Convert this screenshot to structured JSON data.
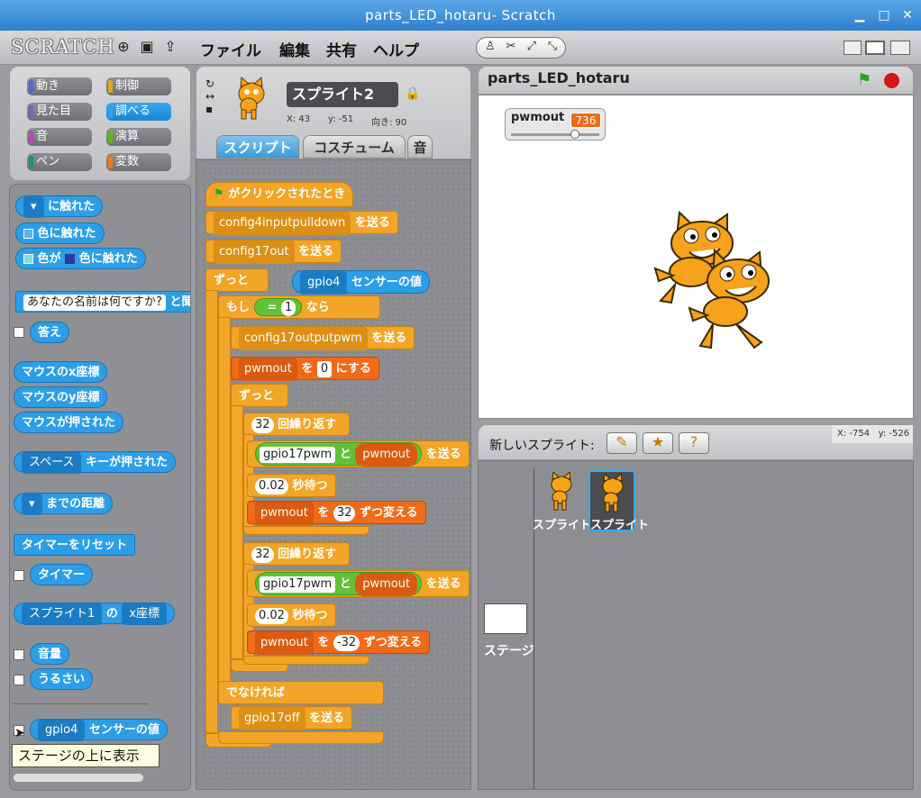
{
  "window": {
    "title": "parts_LED_hotaru- Scratch",
    "minimize_icon": "minimize-icon",
    "maximize_icon": "maximize-icon",
    "close_icon": "close-icon"
  },
  "menubar": {
    "logo": "SCRATCH",
    "menus": [
      "ファイル",
      "編集",
      "共有",
      "ヘルプ"
    ]
  },
  "categories": [
    {
      "label": "動き",
      "color": "#4a6cd4"
    },
    {
      "label": "制御",
      "color": "#e1a91a"
    },
    {
      "label": "見た目",
      "color": "#8a55d7"
    },
    {
      "label": "調べる",
      "color": "#2ca5e2"
    },
    {
      "label": "音",
      "color": "#bb42c3"
    },
    {
      "label": "演算",
      "color": "#5cb712"
    },
    {
      "label": "ペン",
      "color": "#0e9a6c"
    },
    {
      "label": "変数",
      "color": "#ee7d16"
    }
  ],
  "palette": {
    "touching": "に触れた",
    "touching_color": "色に触れた",
    "color_a": "色が",
    "color_touching": "色に触れた",
    "ask_input": "あなたの名前は何ですか?",
    "ask_tail": "と聞い",
    "answer": "答え",
    "mouse_x": "マウスのx座標",
    "mouse_y": "マウスのy座標",
    "mouse_down": "マウスが押された",
    "key_dd": "スペース",
    "key_pressed": "キーが押された",
    "distance": "までの距離",
    "reset_timer": "タイマーをリセット",
    "timer": "タイマー",
    "of_sprite": "スプライト1",
    "of_label": "の",
    "of_attr": "x座標",
    "loudness": "音量",
    "loud": "うるさい",
    "sensor_dd": "gpio4",
    "sensor_label": "センサーの値",
    "tooltip": "ステージの上に表示"
  },
  "sprite": {
    "name": "スプライト2",
    "x_label": "X: 43",
    "y_label": "y: -51",
    "dir_label": "向き: 90"
  },
  "tabs": [
    "スクリプト",
    "コスチューム",
    "音"
  ],
  "script": {
    "hat": "がクリックされたとき",
    "b1_dd": "config4inputpulldown",
    "b1_tail": "を送る",
    "b2_dd": "config17out",
    "b2_tail": "を送る",
    "forever": "ずっと",
    "sensor_dd": "gpio4",
    "sensor_tail": "センサーの値",
    "if": "もし",
    "eq": "=",
    "eq_val": "1",
    "then": "なら",
    "b3_dd": "config17outputpwm",
    "b3_tail": "を送る",
    "setvar_dd": "pwmout",
    "setvar_to": "を",
    "setvar_val": "0",
    "setvar_tail": "にする",
    "forever2": "ずっと",
    "rep1_val": "32",
    "repeat": "回繰り返す",
    "join_a": "gpio17pwm",
    "join_and": "と",
    "join_var": "pwmout",
    "bcast_tail": "を送る",
    "wait1_val": "0.02",
    "wait": "秒待つ",
    "chg1_dd": "pwmout",
    "chg_by": "を",
    "chg1_val": "32",
    "chg_tail": "ずつ変える",
    "rep2_val": "32",
    "join2_a": "gpio17pwm",
    "join2_var": "pwmout",
    "wait2_val": "0.02",
    "chg2_dd": "pwmout",
    "chg2_val": "-32",
    "else": "でなければ",
    "b4_dd": "gpio17off",
    "b4_tail": "を送る"
  },
  "stage": {
    "title": "parts_LED_hotaru",
    "monitor_label": "pwmout",
    "monitor_value": "736",
    "monitor_slider": 0.72,
    "coords_x": "X: -754",
    "coords_y": "y: -526"
  },
  "sprites_panel": {
    "new_sprite": "新しいスプライト:",
    "sprite1": "スプライト",
    "sprite2": "スプライト",
    "stage_label": "ステージ"
  },
  "colors": {
    "accent": "#2ca5e2",
    "control": "#f2a526",
    "operator": "#62c236",
    "variable": "#f06a18",
    "green_flag": "#22aa22",
    "stop": "#d01818"
  }
}
